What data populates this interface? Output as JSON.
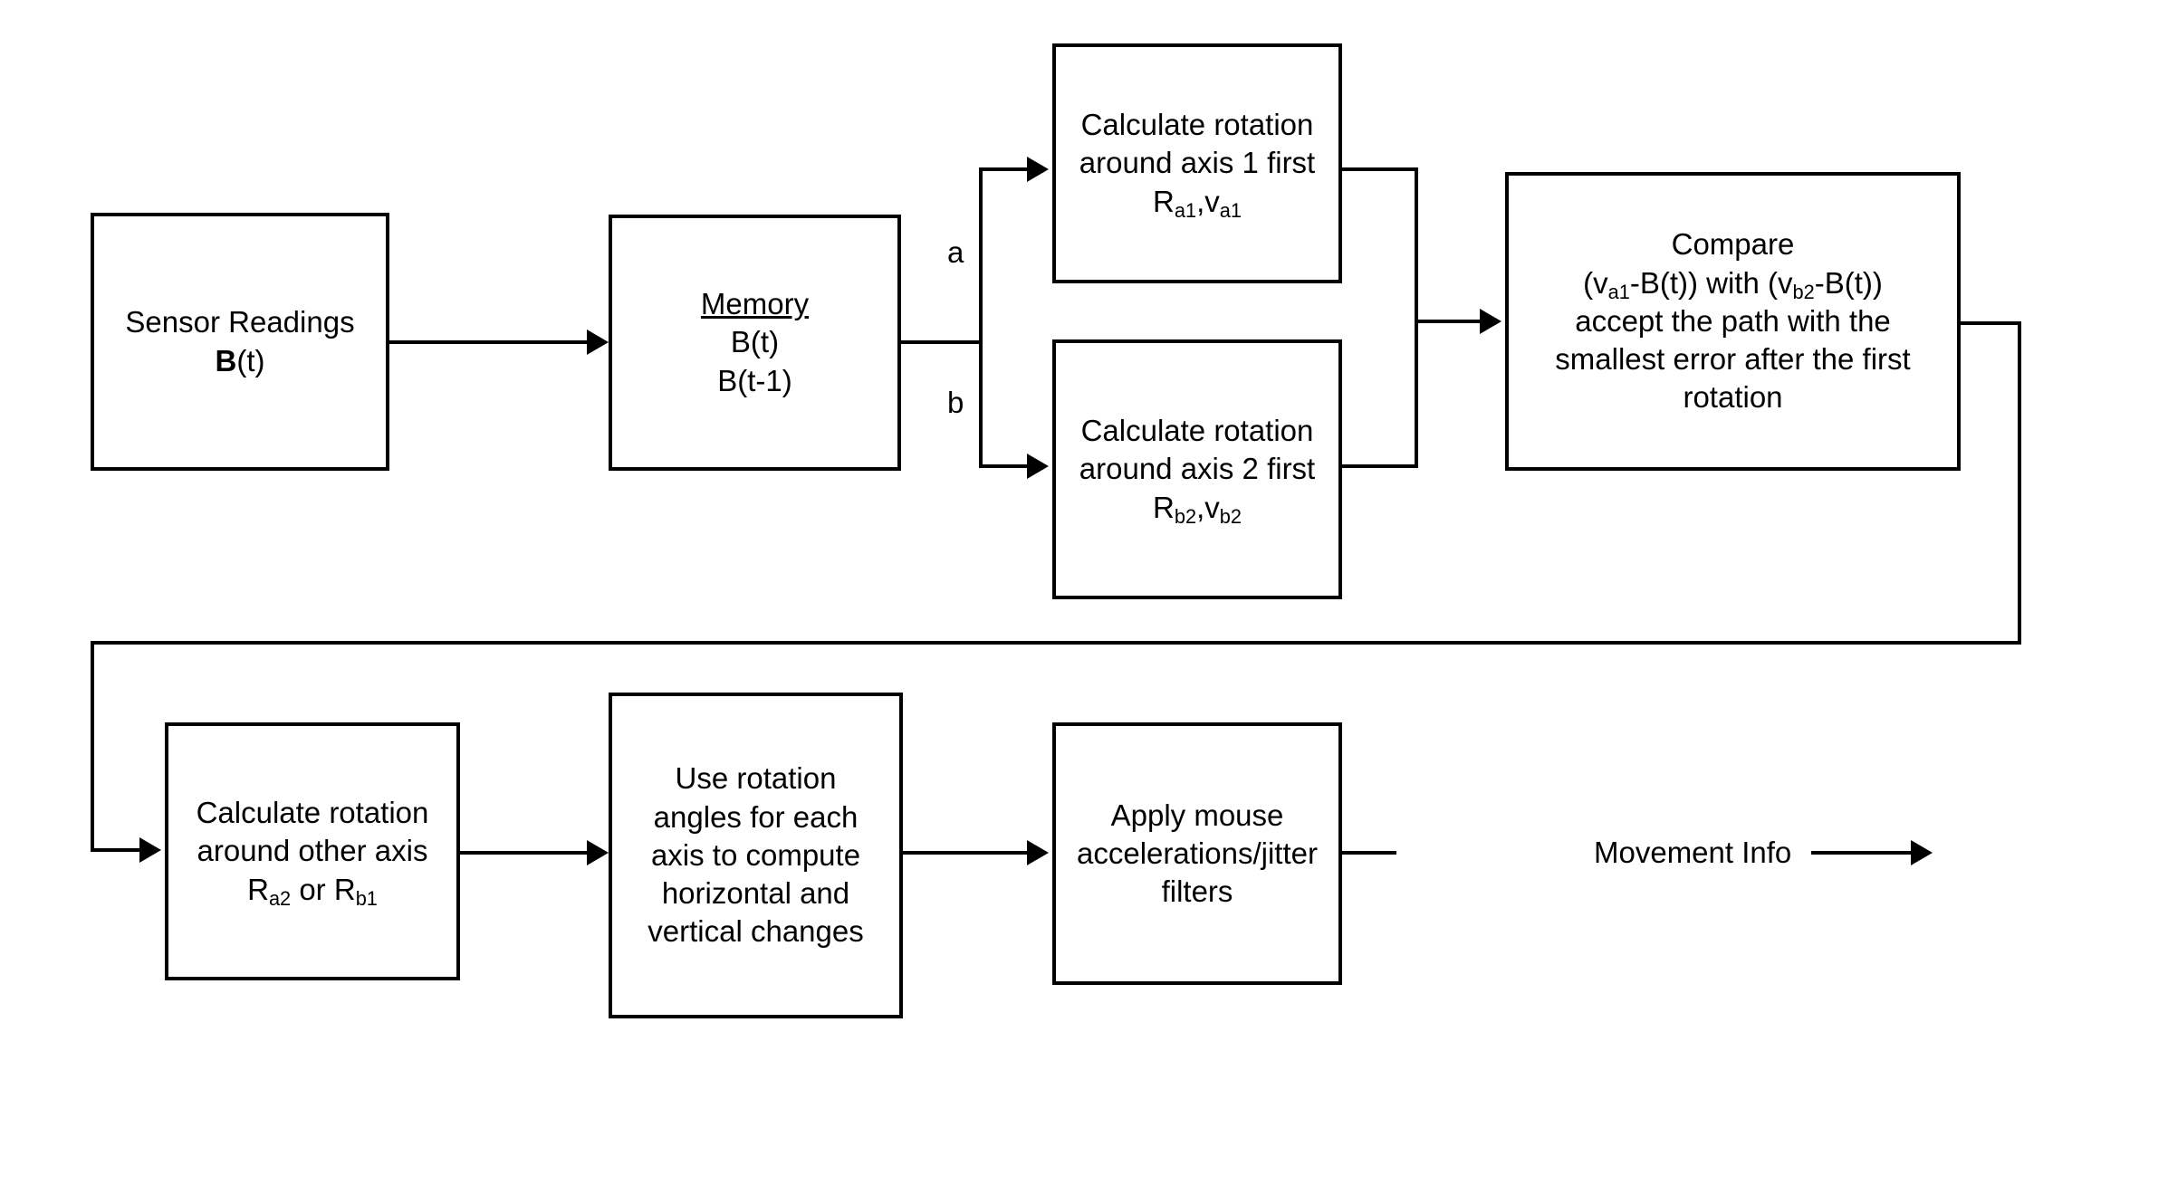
{
  "diagram": {
    "title": "Sensor to mouse movement processing flowchart",
    "stroke_color": "#000000",
    "background_color": "#ffffff"
  },
  "nodes": {
    "sensor_readings": {
      "line1": "Sensor Readings",
      "line2_bold": "B",
      "line2_rest": "(t)"
    },
    "memory": {
      "heading": "Memory",
      "line2": "B(t)",
      "line3": "B(t-1)"
    },
    "rotation_axis1": {
      "line1": "Calculate rotation",
      "line2": "around axis 1 first",
      "sym1": "R",
      "sub1": "a1",
      "comma": ",",
      "sym2": "v",
      "sub2": "a1"
    },
    "rotation_axis2": {
      "line1": "Calculate rotation",
      "line2": "around axis 2 first",
      "sym1": "R",
      "sub1": "b2",
      "comma": ",",
      "sym2": "v",
      "sub2": "b2"
    },
    "compare": {
      "line1": "Compare",
      "l2_a": "(v",
      "l2_sub_a": "a1",
      "l2_b": "-B(t)) with (v",
      "l2_sub_b": "b2",
      "l2_c": "-B(t))",
      "line3": "accept the path with the",
      "line4": "smallest error after the first",
      "line5": "rotation"
    },
    "rotation_other_axis": {
      "line1": "Calculate rotation",
      "line2": "around other axis",
      "sym1": "R",
      "sub1": "a2",
      "joiner": " or ",
      "sym2": "R",
      "sub2": "b1"
    },
    "use_rotation_angles": {
      "line1": "Use rotation",
      "line2": "angles for each",
      "line3": "axis to compute",
      "line4": "horizontal and",
      "line5": "vertical changes"
    },
    "apply_filters": {
      "line1": "Apply mouse",
      "line2": "accelerations/jitter",
      "line3": "filters"
    }
  },
  "labels": {
    "branch_a": "a",
    "branch_b": "b",
    "output": "Movement Info"
  }
}
